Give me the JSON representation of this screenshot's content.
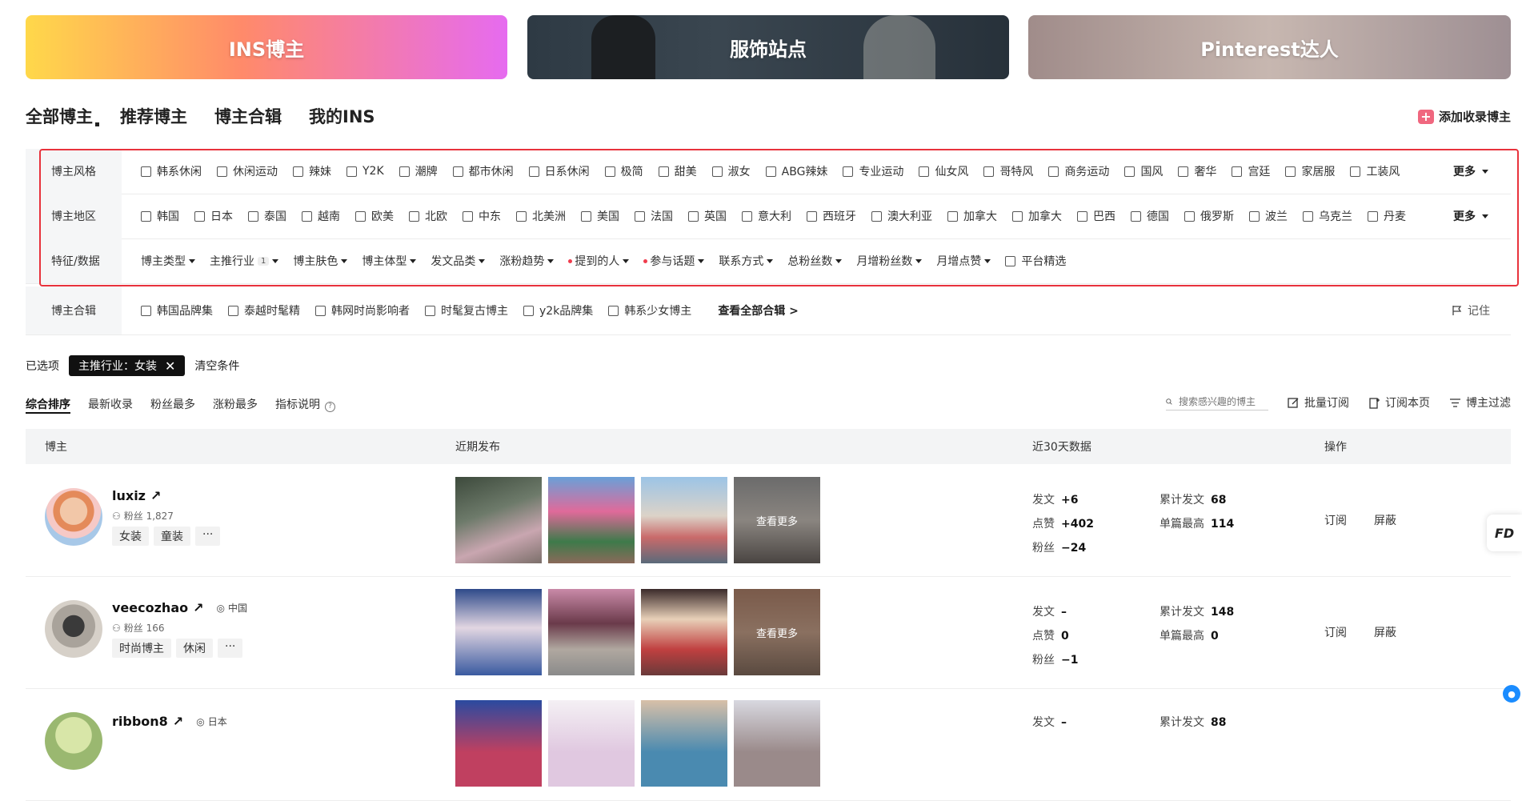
{
  "banners": [
    "INS博主",
    "服饰站点",
    "Pinterest达人"
  ],
  "tabs": [
    "全部博主",
    "推荐博主",
    "博主合辑",
    "我的INS"
  ],
  "add_collect": "添加收录博主",
  "filters": {
    "style": {
      "label": "博主风格",
      "items": [
        "韩系休闲",
        "休闲运动",
        "辣妹",
        "Y2K",
        "潮牌",
        "都市休闲",
        "日系休闲",
        "极简",
        "甜美",
        "淑女",
        "ABG辣妹",
        "专业运动",
        "仙女风",
        "哥特风",
        "商务运动",
        "国风",
        "奢华",
        "宫廷",
        "家居服",
        "工装风"
      ],
      "more": "更多"
    },
    "region": {
      "label": "博主地区",
      "items": [
        "韩国",
        "日本",
        "泰国",
        "越南",
        "欧美",
        "北欧",
        "中东",
        "北美洲",
        "美国",
        "法国",
        "英国",
        "意大利",
        "西班牙",
        "澳大利亚",
        "加拿大",
        "加拿大",
        "巴西",
        "德国",
        "俄罗斯",
        "波兰",
        "乌克兰",
        "丹麦"
      ],
      "more": "更多"
    },
    "feature": {
      "label": "特征/数据",
      "dropdowns": [
        "博主类型",
        "主推行业",
        "博主肤色",
        "博主体型",
        "发文品类",
        "涨粉趋势",
        "提到的人",
        "参与话题",
        "联系方式",
        "总粉丝数",
        "月增粉丝数",
        "月增点赞"
      ],
      "industry_count": "1",
      "checkbox": "平台精选"
    },
    "collection": {
      "label": "博主合辑",
      "items": [
        "韩国品牌集",
        "泰越时髦精",
        "韩网时尚影响者",
        "时髦复古博主",
        "y2k品牌集",
        "韩系少女博主"
      ],
      "see_all": "查看全部合辑 >",
      "remember": "记住"
    }
  },
  "selected": {
    "label": "已选项",
    "chip": "主推行业：女装",
    "clear": "清空条件"
  },
  "sort": [
    "综合排序",
    "最新收录",
    "粉丝最多",
    "涨粉最多",
    "指标说明"
  ],
  "toolbar": {
    "search_placeholder": "搜索感兴趣的博主",
    "batch": "批量订阅",
    "subscribe_page": "订阅本页",
    "filter": "博主过滤"
  },
  "table": {
    "headers": [
      "博主",
      "近期发布",
      "近30天数据",
      "操作"
    ],
    "see_more": "查看更多",
    "rows": [
      {
        "name": "luxiz",
        "location": "",
        "fans": "粉丝 1,827",
        "tags": [
          "女装",
          "童装"
        ],
        "posts": "+6",
        "likes": "+402",
        "fans_change": "−24",
        "total_posts": "68",
        "max_single": "114"
      },
      {
        "name": "veecozhao",
        "location": "中国",
        "fans": "粉丝 166",
        "tags": [
          "时尚博主",
          "休闲"
        ],
        "posts": "–",
        "likes": "0",
        "fans_change": "−1",
        "total_posts": "148",
        "max_single": "0"
      },
      {
        "name": "ribbon8",
        "location": "日本",
        "posts": "–",
        "total_posts": "88"
      }
    ],
    "stat_labels": {
      "posts": "发文",
      "likes": "点赞",
      "fans": "粉丝",
      "total": "累计发文",
      "max": "单篇最高"
    },
    "ops": [
      "订阅",
      "屏蔽"
    ]
  }
}
